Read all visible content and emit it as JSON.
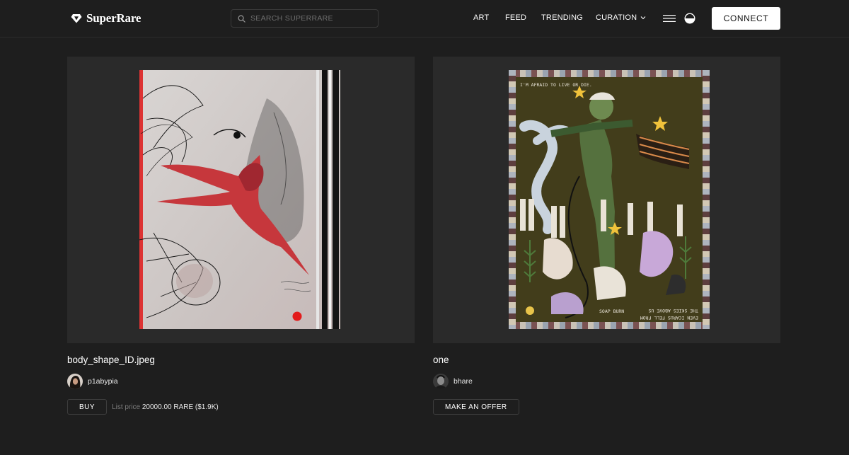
{
  "header": {
    "logo_text": "SuperRare",
    "search_placeholder": "SEARCH SUPERRARE",
    "nav": [
      {
        "label": "ART"
      },
      {
        "label": "FEED"
      },
      {
        "label": "TRENDING"
      },
      {
        "label": "CURATION",
        "has_dropdown": true
      }
    ],
    "connect_label": "CONNECT"
  },
  "colors": {
    "background": "#1e1e1e",
    "card_media": "#2a2a2a",
    "accent_red": "#e31b1b",
    "connect_bg": "#ffffff"
  },
  "cards": [
    {
      "title": "body_shape_ID.jpeg",
      "artist": "p1abypia",
      "action_label": "BUY",
      "price_label": "List price",
      "price_value": "20000.00 RARE ($1.9K)"
    },
    {
      "title": "one",
      "artist": "bhare",
      "action_label": "MAKE AN OFFER",
      "art_text_top": "I'M AFRAID TO LIVE OR DIE.",
      "art_text_bottom_1": "SOAP BURN",
      "art_text_bottom_2": "THE SKIES ABOVE US",
      "art_text_bottom_3": "EVEN ICARUS FELL FROM"
    }
  ]
}
